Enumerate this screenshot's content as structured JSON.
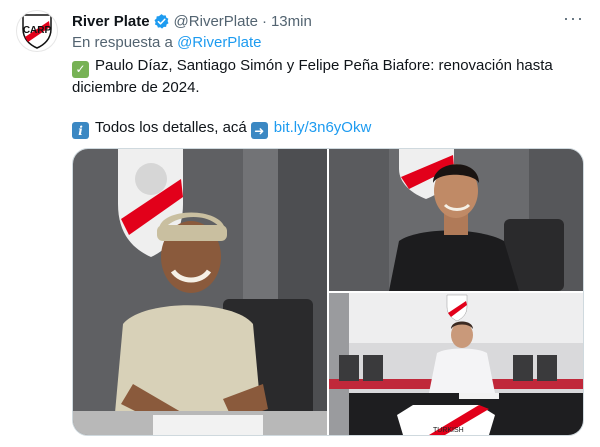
{
  "author": {
    "name": "River Plate",
    "handle": "@RiverPlate",
    "separator": "·",
    "time": "13min"
  },
  "reply": {
    "prefix": "En respuesta a",
    "handle": "@RiverPlate"
  },
  "body": {
    "line1": "Paulo Díaz, Santiago Simón y Felipe Peña Biafore: renovación hasta diciembre de 2024.",
    "line2": "Todos los detalles, acá",
    "url": "bit.ly/3n6yOkw"
  },
  "icons": {
    "avatar": "river-plate-crest-icon",
    "verified": "verified-badge-icon",
    "more": "more-options-icon",
    "emoji1": "check-mark-emoji-icon",
    "emoji2": "information-emoji-icon",
    "emoji3": "right-arrow-emoji-icon"
  },
  "colors": {
    "accent": "#1d9bf0",
    "brand_red": "#e2001a",
    "muted": "#536471"
  },
  "media": {
    "photo_count": 3,
    "photo3_shirt_text": "TURKISH"
  }
}
